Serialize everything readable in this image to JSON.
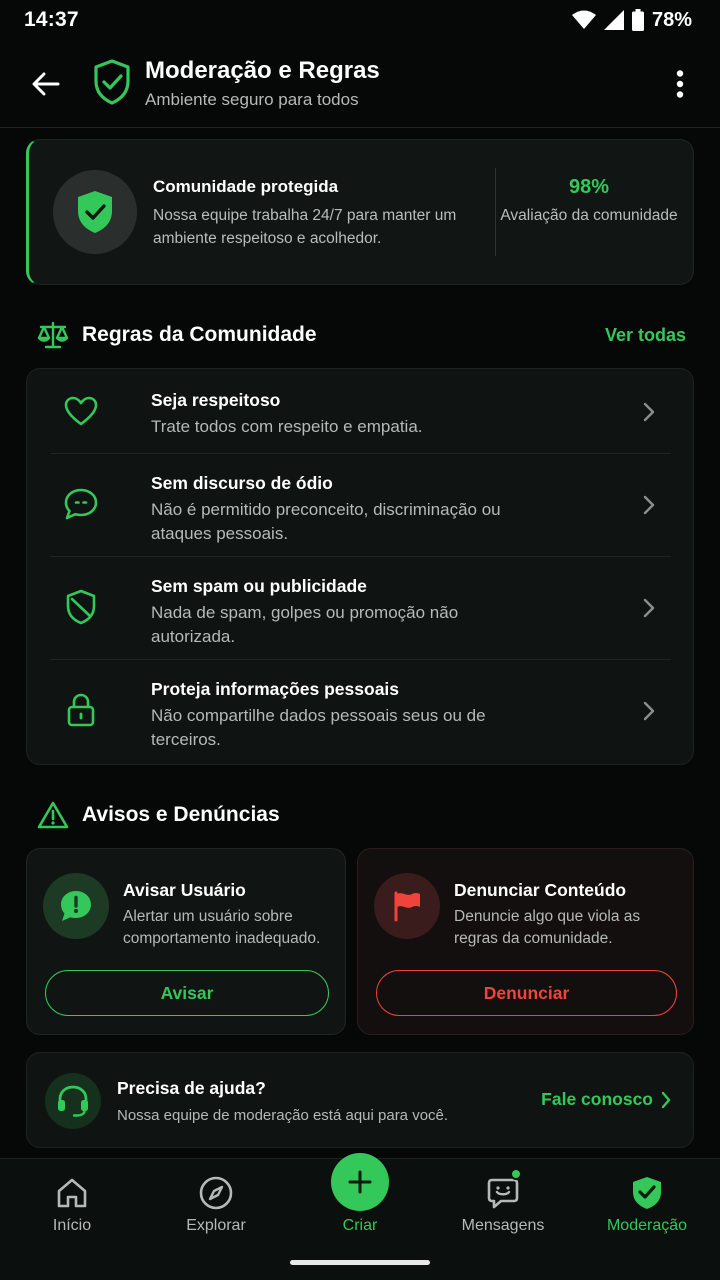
{
  "status_bar": {
    "time": "14:37",
    "battery": "78%"
  },
  "app_bar": {
    "title": "Moderação e Regras",
    "subtitle": "Ambiente seguro para todos"
  },
  "hero": {
    "title": "Comunidade protegida",
    "description": "Nossa equipe trabalha 24/7 para manter um ambiente respeitoso e acolhedor.",
    "stat_value": "98%",
    "stat_label": "Avaliação da comunidade"
  },
  "rules_section": {
    "title": "Regras da Comunidade",
    "link": "Ver todas",
    "items": [
      {
        "icon": "heart-icon",
        "title": "Seja respeitoso",
        "description": "Trate todos com respeito e empatia."
      },
      {
        "icon": "message-ban-icon",
        "title": "Sem discurso de ódio",
        "description": "Não é permitido preconceito, discriminação ou ataques pessoais."
      },
      {
        "icon": "shield-off-icon",
        "title": "Sem spam ou publicidade",
        "description": "Nada de spam, golpes ou promoção não autorizada."
      },
      {
        "icon": "lock-icon",
        "title": "Proteja informações pessoais",
        "description": "Não compartilhe dados pessoais seus ou de terceiros."
      }
    ]
  },
  "alerts_section": {
    "title": "Avisos e Denúncias",
    "warn": {
      "title": "Avisar Usuário",
      "description": "Alertar um usuário sobre comportamento inadequado.",
      "button": "Avisar"
    },
    "report": {
      "title": "Denunciar Conteúdo",
      "description": "Denuncie algo que viola as regras da comunidade.",
      "button": "Denunciar"
    }
  },
  "help": {
    "title": "Precisa de ajuda?",
    "description": "Nossa equipe de moderação está aqui para você.",
    "link": "Fale conosco"
  },
  "bottom_nav": {
    "items": [
      {
        "label": "Início",
        "icon": "home-icon"
      },
      {
        "label": "Explorar",
        "icon": "compass-icon"
      },
      {
        "label": "Criar",
        "icon": "plus-icon"
      },
      {
        "label": "Mensagens",
        "icon": "chat-icon"
      },
      {
        "label": "Moderação",
        "icon": "shield-check-icon"
      }
    ],
    "active": "Moderação"
  },
  "colors": {
    "accent_green": "#34c759",
    "accent_red": "#f0443a",
    "background": "#050807"
  }
}
